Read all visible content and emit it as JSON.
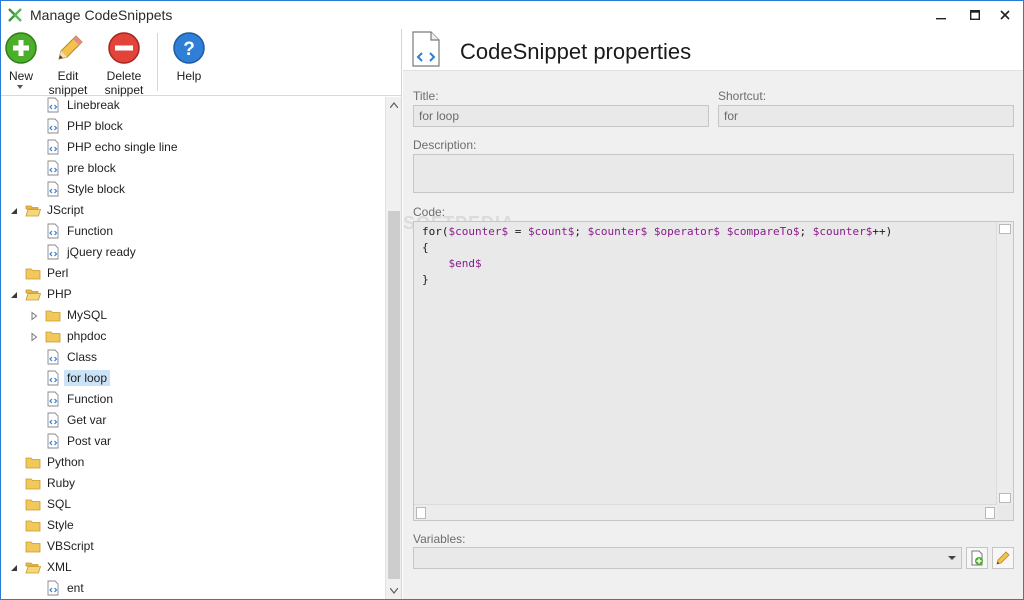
{
  "window": {
    "title": "Manage CodeSnippets"
  },
  "toolbar": {
    "new_label": "New",
    "edit_label_1": "Edit",
    "edit_label_2": "snippet",
    "delete_label_1": "Delete",
    "delete_label_2": "snippet",
    "help_label": "Help"
  },
  "tree": {
    "items": [
      {
        "label": "Linebreak",
        "type": "snippet",
        "level": 2
      },
      {
        "label": "PHP block",
        "type": "snippet",
        "level": 2
      },
      {
        "label": "PHP echo single line",
        "type": "snippet",
        "level": 2
      },
      {
        "label": "pre block",
        "type": "snippet",
        "level": 2
      },
      {
        "label": "Style block",
        "type": "snippet",
        "level": 2
      },
      {
        "label": "JScript",
        "type": "folder-open",
        "level": 1,
        "expander": "expanded"
      },
      {
        "label": "Function",
        "type": "snippet",
        "level": 2
      },
      {
        "label": "jQuery ready",
        "type": "snippet",
        "level": 2
      },
      {
        "label": "Perl",
        "type": "folder",
        "level": 1
      },
      {
        "label": "PHP",
        "type": "folder-open",
        "level": 1,
        "expander": "expanded"
      },
      {
        "label": "MySQL",
        "type": "folder",
        "level": 2,
        "expander": "collapsed"
      },
      {
        "label": "phpdoc",
        "type": "folder",
        "level": 2,
        "expander": "collapsed"
      },
      {
        "label": "Class",
        "type": "snippet",
        "level": 2
      },
      {
        "label": "for loop",
        "type": "snippet",
        "level": 2,
        "selected": true
      },
      {
        "label": "Function",
        "type": "snippet",
        "level": 2
      },
      {
        "label": "Get var",
        "type": "snippet",
        "level": 2
      },
      {
        "label": "Post var",
        "type": "snippet",
        "level": 2
      },
      {
        "label": "Python",
        "type": "folder",
        "level": 1
      },
      {
        "label": "Ruby",
        "type": "folder",
        "level": 1
      },
      {
        "label": "SQL",
        "type": "folder",
        "level": 1
      },
      {
        "label": "Style",
        "type": "folder",
        "level": 1
      },
      {
        "label": "VBScript",
        "type": "folder",
        "level": 1
      },
      {
        "label": "XML",
        "type": "folder-open",
        "level": 1,
        "expander": "expanded"
      },
      {
        "label": "ent",
        "type": "snippet",
        "level": 2
      }
    ]
  },
  "properties": {
    "heading": "CodeSnippet properties",
    "title_label": "Title:",
    "title_value": "for loop",
    "shortcut_label": "Shortcut:",
    "shortcut_value": "for",
    "description_label": "Description:",
    "code_label": "Code:",
    "variables_label": "Variables:"
  },
  "watermark": "SOFTPEDIA",
  "colors": {
    "accent": "#2b7bd4",
    "selection": "#cce3f7",
    "variable": "#8b1a8b",
    "folder": "#f2c75c"
  }
}
